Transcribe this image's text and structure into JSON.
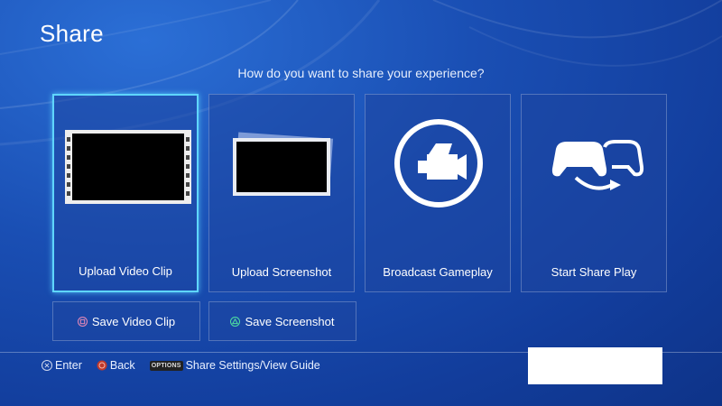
{
  "header": {
    "title": "Share"
  },
  "prompt": "How do you want to share your experience?",
  "tiles": [
    {
      "label": "Upload Video Clip",
      "icon": "film-strip-icon",
      "selected": true
    },
    {
      "label": "Upload Screenshot",
      "icon": "screenshot-stack-icon",
      "selected": false
    },
    {
      "label": "Broadcast Gameplay",
      "icon": "video-camera-icon",
      "selected": false
    },
    {
      "label": "Start Share Play",
      "icon": "controller-share-icon",
      "selected": false
    }
  ],
  "secondary_buttons": [
    {
      "label": "Save Video Clip",
      "glyph": "square-button-icon"
    },
    {
      "label": "Save Screenshot",
      "glyph": "triangle-button-icon"
    }
  ],
  "footer": {
    "enter_label": "Enter",
    "back_label": "Back",
    "options_badge": "OPTIONS",
    "options_label": "Share Settings/View Guide"
  },
  "colors": {
    "highlight": "#5fd6ff",
    "background": "#1a4fb4"
  }
}
